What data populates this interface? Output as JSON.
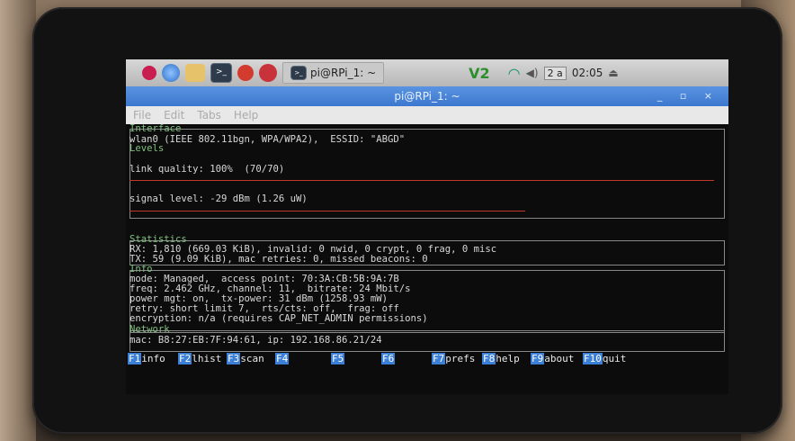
{
  "taskbar": {
    "terminal_task": "pi@RPi_1: ~",
    "vnc": "V2",
    "keyboard": "2 a",
    "clock": "02:05"
  },
  "window": {
    "title": "pi@RPi_1: ~"
  },
  "menu": [
    "File",
    "Edit",
    "Tabs",
    "Help"
  ],
  "wavemon": {
    "interface_header": "Interface",
    "interface_line": "wlan0 (IEEE 802.11bgn, WPA/WPA2),  ESSID: \"ABGD\"",
    "levels_header": "Levels",
    "link_quality": "link quality: 100%  (70/70)",
    "signal_level": "signal level: -29 dBm (1.26 uW)",
    "statistics_header": "Statistics",
    "rx": "RX: 1,810 (669.03 KiB), invalid: 0 nwid, 0 crypt, 0 frag, 0 misc",
    "tx": "TX: 59 (9.09 KiB), mac retries: 0, missed beacons: 0",
    "info_header": "Info",
    "mode": "mode: Managed,  access point: 70:3A:CB:5B:9A:7B",
    "freq": "freq: 2.462 GHz, channel: 11,  bitrate: 24 Mbit/s",
    "power": "power mgt: on,  tx-power: 31 dBm (1258.93 mW)",
    "retry": "retry: short limit 7,  rts/cts: off,  frag: off",
    "encryption": "encryption: n/a (requires CAP_NET_ADMIN permissions)",
    "network_header": "Network",
    "mac": "mac: B8:27:EB:7F:94:61, ip: 192.168.86.21/24"
  },
  "fkeys": [
    {
      "num": "F1",
      "label": "info"
    },
    {
      "num": "F2",
      "label": "lhist"
    },
    {
      "num": "F3",
      "label": "scan"
    },
    {
      "num": "F4",
      "label": ""
    },
    {
      "num": "F5",
      "label": ""
    },
    {
      "num": "F6",
      "label": ""
    },
    {
      "num": "F7",
      "label": "prefs"
    },
    {
      "num": "F8",
      "label": "help"
    },
    {
      "num": "F9",
      "label": "about"
    },
    {
      "num": "F10",
      "label": "quit"
    }
  ]
}
